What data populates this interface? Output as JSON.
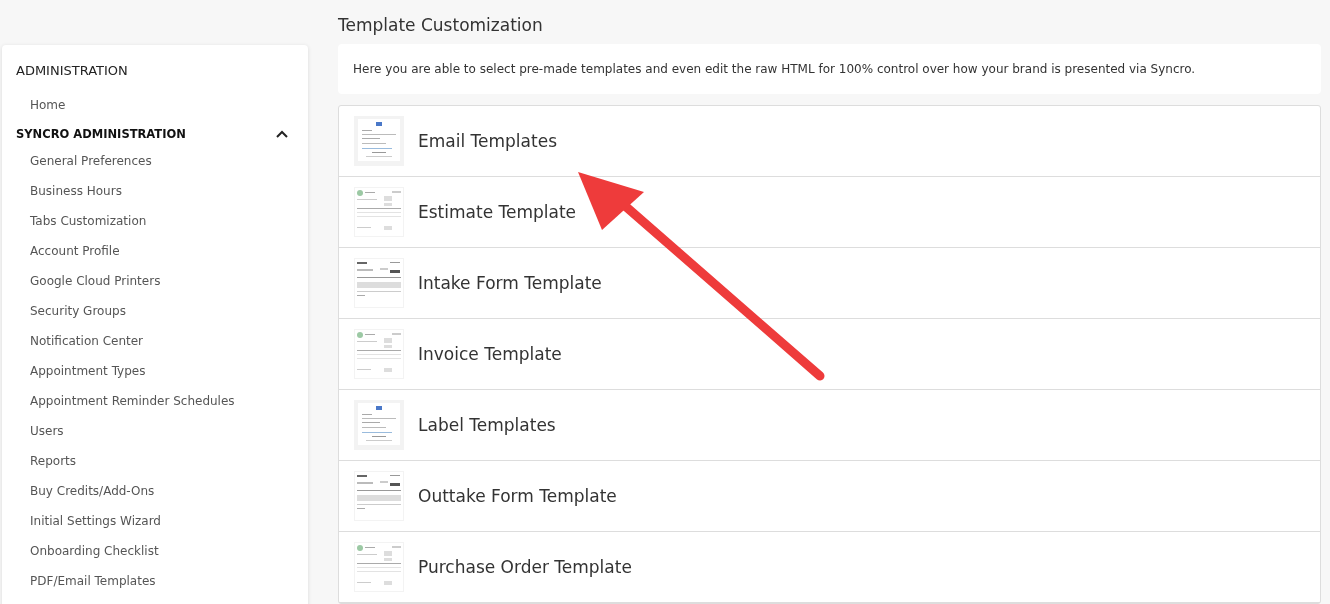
{
  "sidebar": {
    "title": "ADMINISTRATION",
    "items": [
      {
        "label": "Home"
      }
    ],
    "section": {
      "label": "SYNCRO ADMINISTRATION",
      "expanded": true,
      "items": [
        {
          "label": "General Preferences"
        },
        {
          "label": "Business Hours"
        },
        {
          "label": "Tabs Customization"
        },
        {
          "label": "Account Profile"
        },
        {
          "label": "Google Cloud Printers"
        },
        {
          "label": "Security Groups"
        },
        {
          "label": "Notification Center"
        },
        {
          "label": "Appointment Types"
        },
        {
          "label": "Appointment Reminder Schedules"
        },
        {
          "label": "Users"
        },
        {
          "label": "Reports"
        },
        {
          "label": "Buy Credits/Add-Ons"
        },
        {
          "label": "Initial Settings Wizard"
        },
        {
          "label": "Onboarding Checklist"
        },
        {
          "label": "PDF/Email Templates"
        }
      ]
    }
  },
  "page": {
    "title": "Template Customization",
    "description": "Here you are able to select pre-made templates and even edit the raw HTML for 100% control over how your brand is presented via Syncro."
  },
  "templates": [
    {
      "label": "Email Templates",
      "kind": "email"
    },
    {
      "label": "Estimate Template",
      "kind": "invoice"
    },
    {
      "label": "Intake Form Template",
      "kind": "form"
    },
    {
      "label": "Invoice Template",
      "kind": "invoice"
    },
    {
      "label": "Label Templates",
      "kind": "email"
    },
    {
      "label": "Outtake Form Template",
      "kind": "form"
    },
    {
      "label": "Purchase Order Template",
      "kind": "invoice"
    }
  ]
}
